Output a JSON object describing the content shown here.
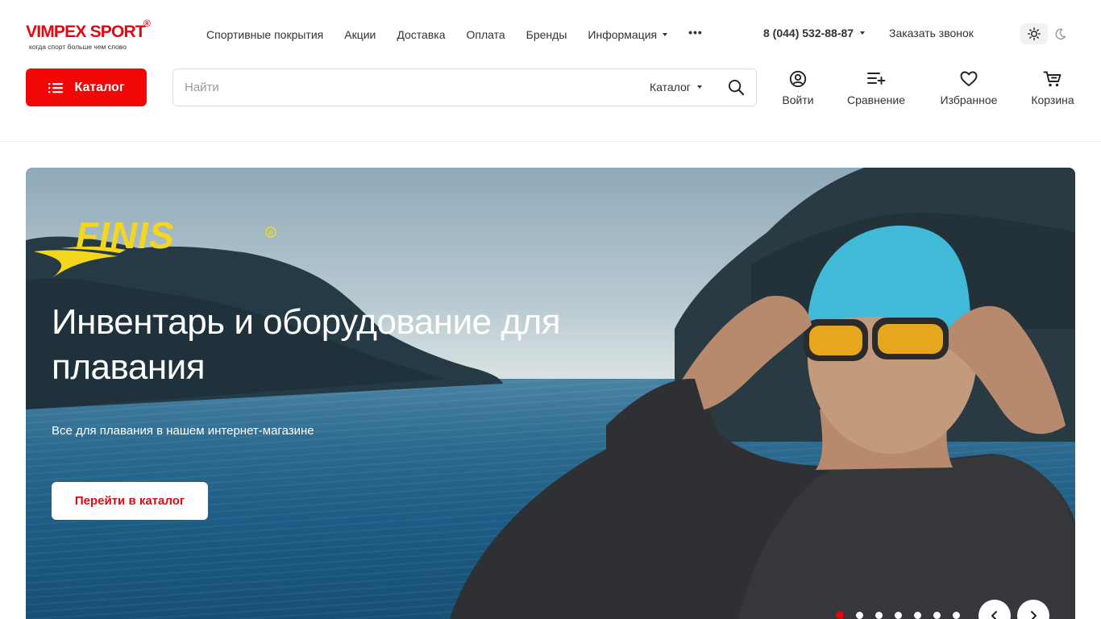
{
  "brand": {
    "name": "VIMPEX SPORT",
    "registered": "®",
    "tagline": "когда спорт больше чем слово",
    "accent_color": "#e30613"
  },
  "topnav": {
    "items": [
      {
        "label": "Спортивные покрытия"
      },
      {
        "label": "Акции"
      },
      {
        "label": "Доставка"
      },
      {
        "label": "Оплата"
      },
      {
        "label": "Бренды"
      },
      {
        "label": "Информация",
        "has_dropdown": true
      }
    ],
    "more_label": "•••"
  },
  "contact": {
    "phone": "8 (044) 532-88-87",
    "callback_label": "Заказать звонок"
  },
  "theme": {
    "light_icon": "sun-icon",
    "dark_icon": "moon-icon",
    "selected": "light"
  },
  "catalog_button": {
    "label": "Каталог",
    "icon": "list-icon"
  },
  "search": {
    "placeholder": "Найти",
    "value": "",
    "scope_label": "Каталог",
    "icon": "search-icon"
  },
  "actions": [
    {
      "label": "Войти",
      "icon": "user-icon"
    },
    {
      "label": "Сравнение",
      "icon": "compare-icon"
    },
    {
      "label": "Избранное",
      "icon": "heart-icon"
    },
    {
      "label": "Корзина",
      "icon": "cart-icon"
    }
  ],
  "hero": {
    "brand_logo_text": "FINIS",
    "title": "Инвентарь и оборудование для плавания",
    "subtitle": "Все для плавания в нашем интернет-магазине",
    "button_label": "Перейти в каталог",
    "slides_count": 7,
    "active_slide": 1,
    "prev_icon": "chevron-left-icon",
    "next_icon": "chevron-right-icon"
  }
}
